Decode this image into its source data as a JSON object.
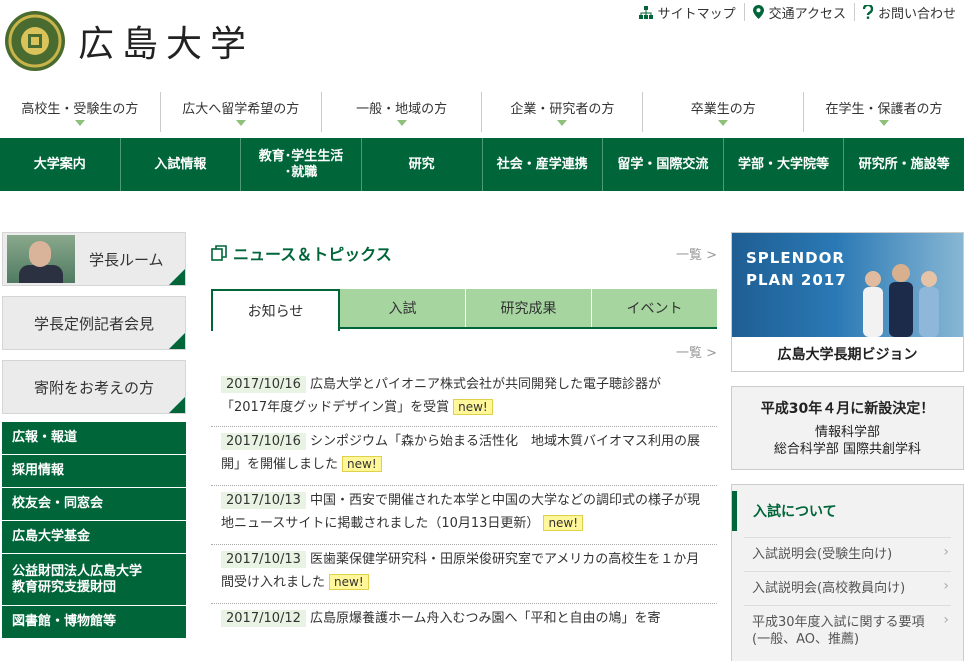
{
  "header": {
    "logo_text": "広島大学",
    "utility_links": [
      {
        "label": "サイトマップ",
        "icon": "sitemap-icon"
      },
      {
        "label": "交通アクセス",
        "icon": "map-pin-icon"
      },
      {
        "label": "お問い合わせ",
        "icon": "question-icon"
      }
    ]
  },
  "audience_nav": [
    "高校生・受験生の方",
    "広大へ留学希望の方",
    "一般・地域の方",
    "企業・研究者の方",
    "卒業生の方",
    "在学生・保護者の方"
  ],
  "global_nav": [
    "大学案内",
    "入試情報",
    "教育･学生生活\n･就職",
    "研究",
    "社会・産学連携",
    "留学・国際交流",
    "学部・大学院等",
    "研究所・施設等"
  ],
  "left_sidebar": {
    "president_room": "学長ルーム",
    "press": "学長定例記者会見",
    "donation": "寄附をお考えの方",
    "links": [
      "広報・報道",
      "採用情報",
      "校友会・同窓会",
      "広島大学基金",
      "公益財団法人広島大学\n教育研究支援財団",
      "図書館・博物館等"
    ]
  },
  "news": {
    "title": "ニュース＆トピックス",
    "more": "一覧 >",
    "tabs": [
      "お知らせ",
      "入試",
      "研究成果",
      "イベント"
    ],
    "active_tab": "お知らせ",
    "more2": "一覧 >",
    "new_label": "new!",
    "items": [
      {
        "date": "2017/10/16",
        "text": "広島大学とパイオニア株式会社が共同開発した電子聴診器が「2017年度グッドデザイン賞」を受賞"
      },
      {
        "date": "2017/10/16",
        "text": "シンポジウム「森から始まる活性化　地域木質バイオマス利用の展開」を開催しました"
      },
      {
        "date": "2017/10/13",
        "text": "中国・西安で開催された本学と中国の大学などの調印式の様子が現地ニュースサイトに掲載されました（10月13日更新）"
      },
      {
        "date": "2017/10/13",
        "text": "医歯薬保健学研究科・田原栄俊研究室でアメリカの高校生を１か月間受け入れました"
      },
      {
        "date": "2017/10/12",
        "text": "広島原爆養護ホーム舟入むつみ園へ「平和と自由の鳩」を寄"
      }
    ]
  },
  "right_sidebar": {
    "banner_text_1": "SPLENDOR",
    "banner_text_2": "PLAN 2017",
    "banner_caption": "広島大学長期ビジョン",
    "notice_title": "平成30年４月に新設決定！",
    "notice_line1": "情報科学部",
    "notice_line2": "総合科学部 国際共創学科",
    "nyushi_title": "入試について",
    "nyushi_links": [
      "入試説明会(受験生向け)",
      "入試説明会(高校教員向け)",
      "平成30年度入試に関する要項(一般、AO、推薦)"
    ]
  },
  "colors": {
    "brand_green": "#00663a",
    "tab_green": "#a6d5a0",
    "new_badge": "#fff799"
  }
}
